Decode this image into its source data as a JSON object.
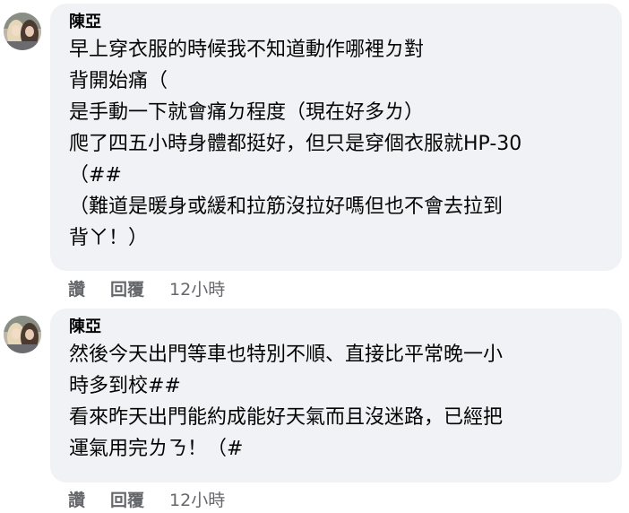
{
  "comments": [
    {
      "author": "陳亞",
      "lines": [
        "早上穿衣服的時候我不知道動作哪裡ㄉ對",
        "背開始痛（",
        "是手動一下就會痛ㄉ程度（現在好多ㄌ）",
        "爬了四五小時身體都挺好，但只是穿個衣服就HP-30",
        "（##",
        "（難道是暖身或緩和拉筋沒拉好嗎但也不會去拉到",
        "背ㄚ！）"
      ],
      "like_label": "讚",
      "reply_label": "回覆",
      "timestamp": "12小時"
    },
    {
      "author": "陳亞",
      "lines": [
        "然後今天出門等車也特別不順、直接比平常晚一小",
        "時多到校##",
        "看來昨天出門能約成能好天氣而且沒迷路，已經把",
        "運氣用完ㄌㄋ！（#"
      ],
      "like_label": "讚",
      "reply_label": "回覆",
      "timestamp": "12小時"
    }
  ]
}
